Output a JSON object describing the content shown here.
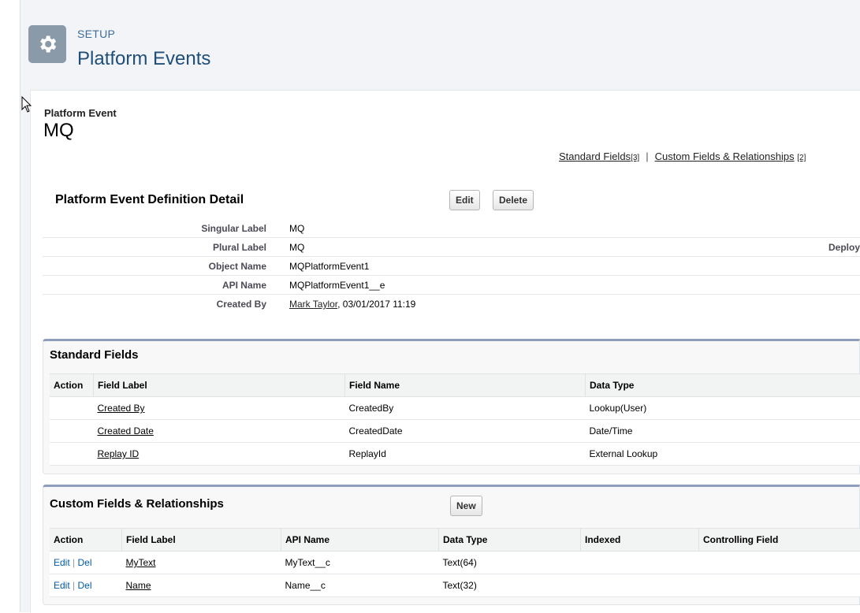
{
  "header": {
    "section": "SETUP",
    "title": "Platform Events"
  },
  "object": {
    "type_label": "Platform Event",
    "name": "MQ"
  },
  "related_links": {
    "standard": "Standard Fields",
    "standard_count": "[3]",
    "separator": "|",
    "custom": "Custom Fields & Relationships",
    "custom_count": "[2]"
  },
  "detail": {
    "title": "Platform Event Definition Detail",
    "edit_label": "Edit",
    "delete_label": "Delete",
    "rows": [
      {
        "label": "Singular Label",
        "value": "MQ"
      },
      {
        "label": "Plural Label",
        "value": "MQ",
        "extra": "Deploy"
      },
      {
        "label": "Object Name",
        "value": "MQPlatformEvent1"
      },
      {
        "label": "API Name",
        "value": "MQPlatformEvent1__e"
      },
      {
        "label": "Created By",
        "value_link": "Mark Taylor",
        "value": ", 03/01/2017 11:19"
      }
    ]
  },
  "standard_fields": {
    "title": "Standard Fields",
    "columns": [
      "Action",
      "Field Label",
      "Field Name",
      "Data Type"
    ],
    "rows": [
      {
        "label": "Created By",
        "name": "CreatedBy",
        "type": "Lookup(User)"
      },
      {
        "label": "Created Date",
        "name": "CreatedDate",
        "type": "Date/Time"
      },
      {
        "label": "Replay ID",
        "name": "ReplayId",
        "type": "External Lookup"
      }
    ]
  },
  "custom_fields": {
    "title": "Custom Fields & Relationships",
    "new_label": "New",
    "columns": [
      "Action",
      "Field Label",
      "API Name",
      "Data Type",
      "Indexed",
      "Controlling Field"
    ],
    "rows": [
      {
        "edit": "Edit",
        "sep": "|",
        "del": "Del",
        "label": "MyText",
        "api": "MyText__c",
        "type": "Text(64)"
      },
      {
        "edit": "Edit",
        "sep": "|",
        "del": "Del",
        "label": "Name",
        "api": "Name__c",
        "type": "Text(32)"
      }
    ]
  },
  "colors": {
    "accent": "#8e9dbe",
    "link": "#015ba7",
    "setup_icon_bg": "#8a9aa9"
  },
  "icons": {
    "setup": "gear-icon",
    "cursor": "mouse-pointer-icon"
  }
}
